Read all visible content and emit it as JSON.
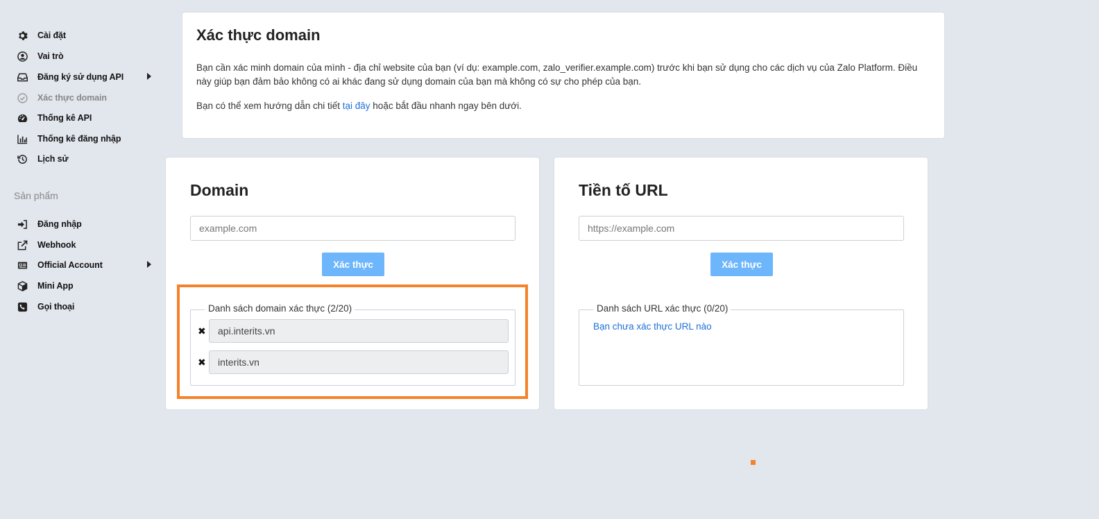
{
  "sidebar": {
    "items": [
      {
        "label": "Cài đặt",
        "icon": "gear-icon"
      },
      {
        "label": "Vai trò",
        "icon": "user-circle-icon"
      },
      {
        "label": "Đăng ký sử dụng API",
        "icon": "inbox-icon"
      },
      {
        "label": "Xác thực domain",
        "icon": "check-circle-icon"
      },
      {
        "label": "Thống kê API",
        "icon": "gauge-icon"
      },
      {
        "label": "Thống kê đăng nhập",
        "icon": "bar-chart-icon"
      },
      {
        "label": "Lịch sử",
        "icon": "history-icon"
      }
    ],
    "section_title": "Sản phẩm",
    "products": [
      {
        "label": "Đăng nhập",
        "icon": "sign-in-icon"
      },
      {
        "label": "Webhook",
        "icon": "external-link-icon"
      },
      {
        "label": "Official Account",
        "icon": "id-card-icon"
      },
      {
        "label": "Mini App",
        "icon": "cube-icon"
      },
      {
        "label": "Gọi thoại",
        "icon": "phone-icon"
      }
    ]
  },
  "header": {
    "title": "Xác thực domain",
    "description": "Bạn cần xác minh domain của mình - địa chỉ website của bạn (ví dụ: example.com, zalo_verifier.example.com) trước khi bạn sử dụng cho các dịch vụ của Zalo Platform. Điều này giúp bạn đảm bảo không có ai khác đang sử dụng domain của bạn mà không có sự cho phép của bạn.",
    "hint_before": "Bạn có thể xem hướng dẫn chi tiết ",
    "hint_link": "tại đây",
    "hint_after": " hoặc bắt đầu nhanh ngay bên dưới."
  },
  "domain_panel": {
    "title": "Domain",
    "placeholder": "example.com",
    "button_label": "Xác thực",
    "list_legend": "Danh sách domain xác thực (2/20)",
    "domains": [
      "api.interits.vn",
      "interits.vn"
    ],
    "remove_glyph": "✖"
  },
  "url_panel": {
    "title": "Tiền tố URL",
    "placeholder": "https://example.com",
    "button_label": "Xác thực",
    "list_legend": "Danh sách URL xác thực (0/20)",
    "empty_message": "Bạn chưa xác thực URL nào"
  },
  "colors": {
    "accent": "#6db6fb",
    "link": "#1e6fd9",
    "highlight": "#f5822a",
    "background": "#e2e6ed"
  }
}
